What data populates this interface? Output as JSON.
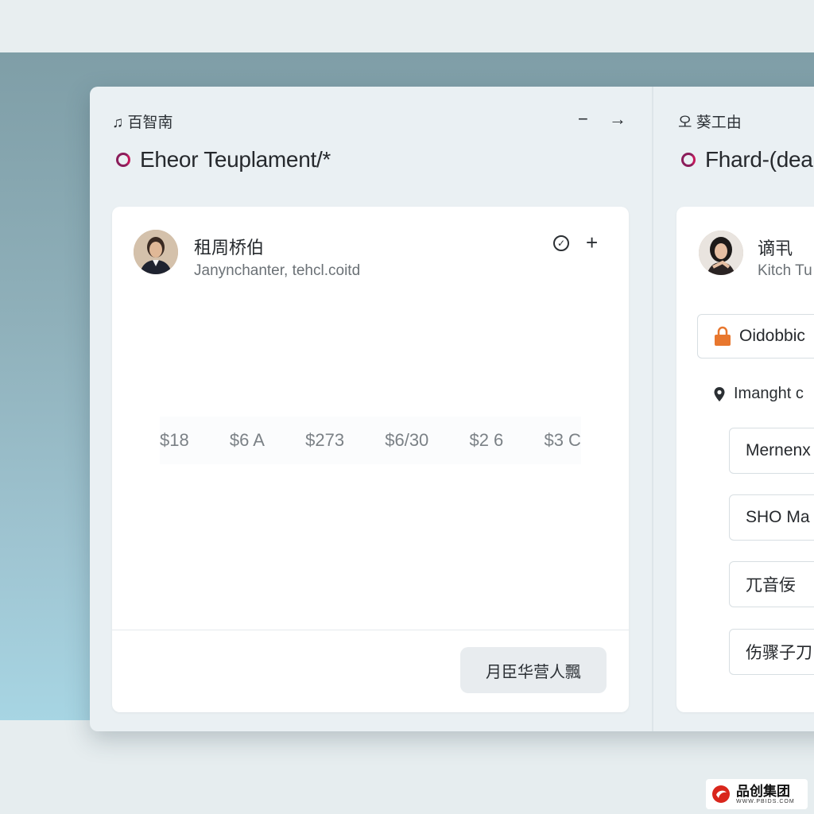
{
  "left_pane": {
    "label": "♫ 百智南",
    "title": "Eheor Teuplament/*",
    "controls": {
      "minimize": "−",
      "next": "→"
    },
    "card": {
      "name": "租周桥伯",
      "subtitle": "Janynchanter, tehcl.coitd",
      "check_icon": "✓",
      "add_icon": "+",
      "prices": [
        "$18",
        "$6 A",
        "$273",
        "$6/30",
        "$2 6",
        "$3 C"
      ],
      "footer_button": "月臣华营人飄"
    }
  },
  "right_pane": {
    "label": "오 葵工由",
    "title": "Fhard-(dea",
    "card": {
      "name": "谪丮",
      "subtitle": "Kitch Tu",
      "lock_field": "Oidobbic",
      "location": "Imanght c",
      "fields": [
        "Mernenx",
        "SHO Ma",
        "兀音佞",
        "伤骤子刀"
      ]
    }
  },
  "watermark": {
    "text": "品创集团",
    "url": "WWW.PBIDS.COM"
  },
  "colors": {
    "brand_logo": "#8b1d5a",
    "lock_icon": "#e8772e"
  }
}
